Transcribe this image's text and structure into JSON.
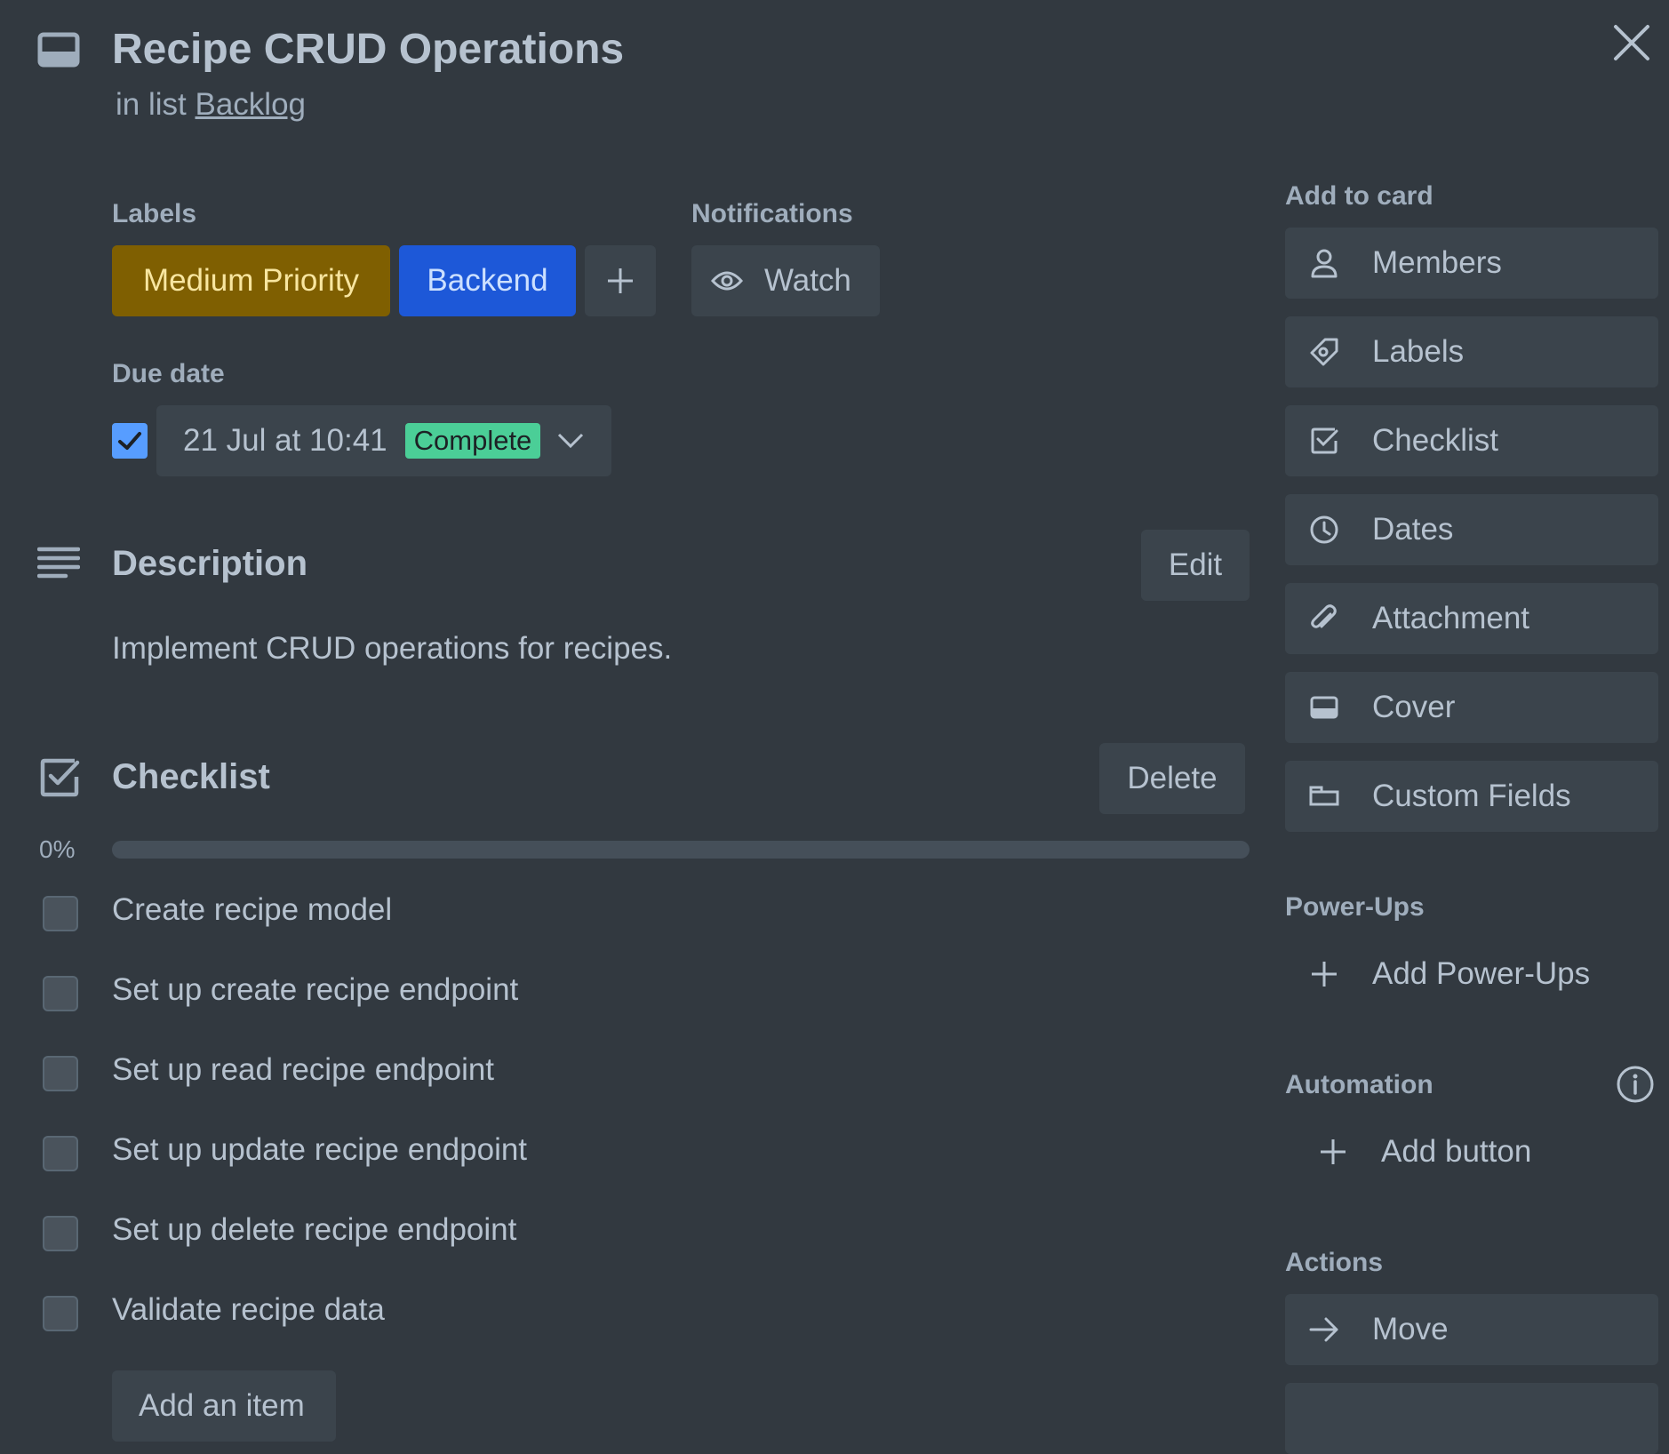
{
  "card": {
    "title": "Recipe CRUD Operations",
    "list_prefix": "in list",
    "list_name": "Backlog"
  },
  "labels_section": {
    "heading": "Labels",
    "labels": [
      {
        "text": "Medium Priority",
        "color": "#7f5f01",
        "text_color": "#f8e6a0"
      },
      {
        "text": "Backend",
        "color": "#1d58d8",
        "text_color": "#cce0ff"
      }
    ]
  },
  "notifications": {
    "heading": "Notifications",
    "watch_label": "Watch"
  },
  "due_date": {
    "heading": "Due date",
    "checked": true,
    "value": "21 Jul at 10:41",
    "status": "Complete",
    "status_color": "#4bce97"
  },
  "description": {
    "heading": "Description",
    "edit_label": "Edit",
    "text": "Implement CRUD operations for recipes."
  },
  "checklist": {
    "heading": "Checklist",
    "delete_label": "Delete",
    "progress_text": "0%",
    "progress": 0,
    "items": [
      {
        "text": "Create recipe model",
        "checked": false
      },
      {
        "text": "Set up create recipe endpoint",
        "checked": false
      },
      {
        "text": "Set up read recipe endpoint",
        "checked": false
      },
      {
        "text": "Set up update recipe endpoint",
        "checked": false
      },
      {
        "text": "Set up delete recipe endpoint",
        "checked": false
      },
      {
        "text": "Validate recipe data",
        "checked": false
      }
    ],
    "add_item_label": "Add an item"
  },
  "sidebar": {
    "add_to_card_heading": "Add to card",
    "add_to_card": [
      {
        "label": "Members",
        "icon": "person-icon"
      },
      {
        "label": "Labels",
        "icon": "tag-icon"
      },
      {
        "label": "Checklist",
        "icon": "checklist-icon"
      },
      {
        "label": "Dates",
        "icon": "clock-icon"
      },
      {
        "label": "Attachment",
        "icon": "paperclip-icon"
      },
      {
        "label": "Cover",
        "icon": "cover-icon"
      },
      {
        "label": "Custom Fields",
        "icon": "custom-fields-icon"
      }
    ],
    "powerups_heading": "Power-Ups",
    "add_powerups_label": "Add Power-Ups",
    "automation_heading": "Automation",
    "add_button_label": "Add button",
    "actions_heading": "Actions",
    "move_label": "Move"
  },
  "colors": {
    "background": "#323940",
    "button": "#3b444c",
    "text": "#b6c2cf",
    "checkbox_checked": "#579dff"
  }
}
